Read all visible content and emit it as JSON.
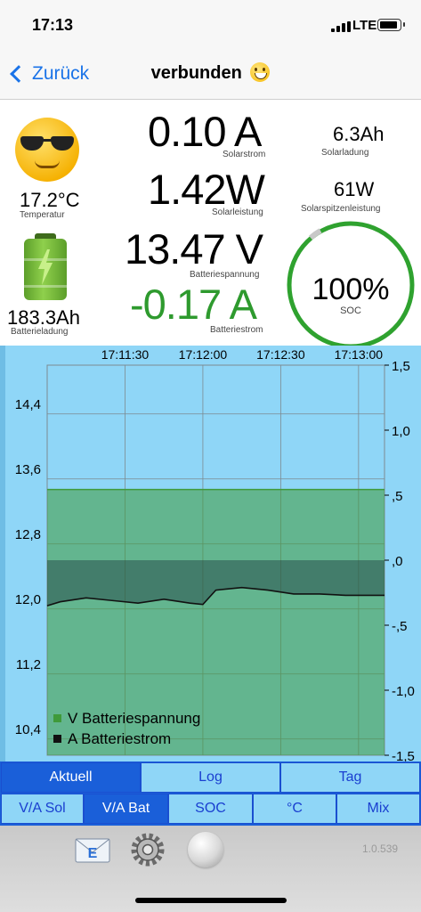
{
  "status_bar": {
    "time": "17:13",
    "network": "LTE"
  },
  "nav": {
    "back_label": "Zurück",
    "title": "verbunden"
  },
  "readings": {
    "temperature": {
      "value": "17.2°C",
      "label": "Temperatur"
    },
    "battery_charge": {
      "value": "183.3Ah",
      "label": "Batterieladung"
    },
    "solar_current": {
      "value": "0.10 A",
      "label": "Solarstrom"
    },
    "solar_power": {
      "value": "1.42W",
      "label": "Solarleistung"
    },
    "battery_voltage": {
      "value": "13.47 V",
      "label": "Batteriespannung"
    },
    "battery_current": {
      "value": "-0.17 A",
      "label": "Batteriestrom"
    },
    "solar_charge": {
      "value": "6.3Ah",
      "label": "Solarladung"
    },
    "solar_peak_power": {
      "value": "61W",
      "label": "Solarspitzenleistung"
    },
    "soc": {
      "value": "100%",
      "label": "SOC",
      "level": 1.0
    }
  },
  "colors": {
    "voltage": "#3f9a3a",
    "current": "#111111",
    "chart_bg": "#8fd6f7",
    "tab_active": "#1a5fd9"
  },
  "chart_data": {
    "type": "line",
    "x_ticks": [
      "17:11:30",
      "17:12:00",
      "17:12:30",
      "17:13:00"
    ],
    "y_left_ticks": [
      "14,4",
      "13,6",
      "12,8",
      "12,0",
      "11,2",
      "10,4"
    ],
    "y_right_ticks": [
      "1,5",
      "1,0",
      ",5",
      ",0",
      "-,5",
      "-1,0",
      "-1,5"
    ],
    "ylim_left": [
      10.2,
      15.0
    ],
    "ylim_right": [
      -1.5,
      1.5
    ],
    "grid": true,
    "legend": "bottom-left",
    "series": [
      {
        "name": "V Batteriespannung",
        "axis": "left",
        "x": [
          "17:11:00",
          "17:11:30",
          "17:12:00",
          "17:12:30",
          "17:13:00",
          "17:13:10"
        ],
        "values": [
          13.47,
          13.47,
          13.47,
          13.47,
          13.47,
          13.47
        ]
      },
      {
        "name": "A Batteriestrom",
        "axis": "right",
        "x": [
          "17:11:00",
          "17:11:05",
          "17:11:15",
          "17:11:25",
          "17:11:35",
          "17:11:45",
          "17:11:55",
          "17:12:00",
          "17:12:05",
          "17:12:15",
          "17:12:25",
          "17:12:35",
          "17:12:45",
          "17:12:55",
          "17:13:05",
          "17:13:10"
        ],
        "values": [
          -0.35,
          -0.32,
          -0.29,
          -0.31,
          -0.33,
          -0.3,
          -0.33,
          -0.34,
          -0.23,
          -0.21,
          -0.23,
          -0.26,
          -0.26,
          -0.27,
          -0.27,
          -0.27
        ]
      }
    ]
  },
  "tabs_top": [
    "Aktuell",
    "Log",
    "Tag"
  ],
  "tabs_bottom": [
    "V/A Sol",
    "V/A Bat",
    "SOC",
    "°C",
    "Mix"
  ],
  "toolbar": {
    "mail_letter": "E",
    "version": "1.0.539"
  }
}
